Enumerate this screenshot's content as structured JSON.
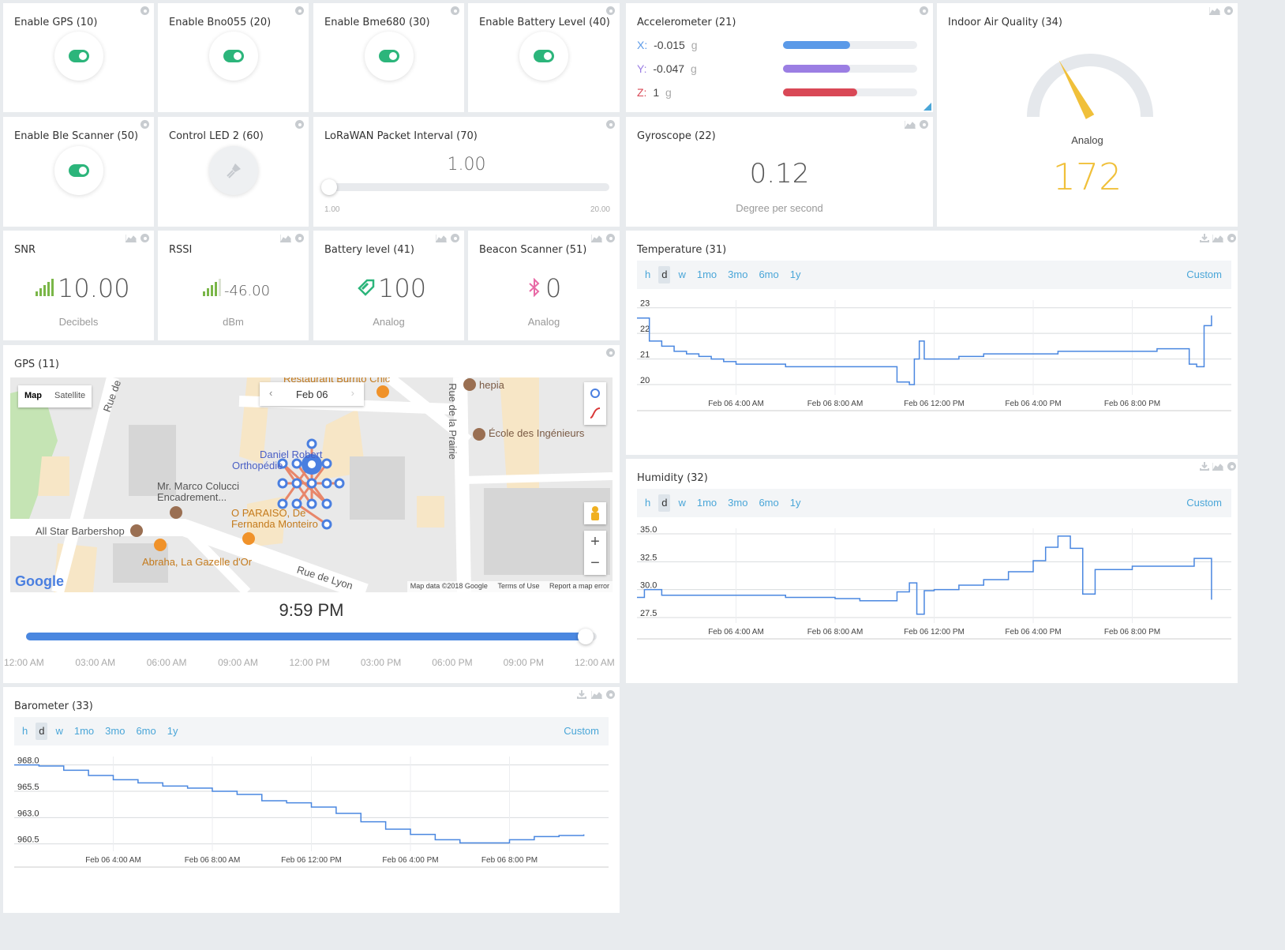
{
  "colors": {
    "accent": "#4a87e0",
    "toggle_on": "#2cb57b",
    "tab_link": "#4aa6d8",
    "gauge": "#f0c03a",
    "battery": "#2cb57b",
    "ble": "#e86aa6",
    "acc_x": "#5b9ae8",
    "acc_y": "#9b7ee3",
    "acc_z": "#d94856"
  },
  "toggles": [
    {
      "title": "Enable GPS (10)",
      "icon": "toggle-on-icon"
    },
    {
      "title": "Enable Bno055 (20)",
      "icon": "toggle-on-icon"
    },
    {
      "title": "Enable Bme680 (30)",
      "icon": "toggle-on-icon"
    },
    {
      "title": "Enable Battery Level (40)",
      "icon": "toggle-on-icon"
    },
    {
      "title": "Enable Ble Scanner (50)",
      "icon": "toggle-on-icon"
    }
  ],
  "led": {
    "title": "Control LED 2 (60)",
    "icon": "led-bulb-icon"
  },
  "lorawan": {
    "title": "LoRaWAN Packet Interval (70)",
    "value": "1.00",
    "min": "1.00",
    "max": "20.00",
    "level": 0.0
  },
  "accelerometer": {
    "title": "Accelerometer (21)",
    "rows": [
      {
        "axis": "X:",
        "value": "-0.015",
        "unit": "g",
        "level": 0.5
      },
      {
        "axis": "Y:",
        "value": "-0.047",
        "unit": "g",
        "level": 0.5
      },
      {
        "axis": "Z:",
        "value": "1",
        "unit": "g",
        "level": 0.55
      }
    ]
  },
  "iaq": {
    "title": "Indoor Air Quality (34)",
    "label": "Analog",
    "value": "172",
    "level": 0.34
  },
  "gyro": {
    "title": "Gyroscope (22)",
    "value": "0.12",
    "unit": "Degree per second"
  },
  "snr": {
    "title": "SNR",
    "value": "10.00",
    "unit": "Decibels",
    "icon": "signal-bars-icon"
  },
  "rssi": {
    "title": "RSSI",
    "value": "-46.00",
    "unit": "dBm",
    "icon": "signal-bars-icon"
  },
  "battery": {
    "title": "Battery level (41)",
    "value": "100",
    "unit": "Analog",
    "icon": "battery-tag-icon"
  },
  "beacon": {
    "title": "Beacon Scanner (51)",
    "value": "0",
    "unit": "Analog",
    "icon": "bluetooth-icon"
  },
  "gps": {
    "title": "GPS (11)",
    "map_type": [
      "Map",
      "Satellite"
    ],
    "date": "Feb 06",
    "time": "9:59 PM",
    "timeline_level": 0.98,
    "timeline_labels": [
      "12:00 AM",
      "03:00 AM",
      "06:00 AM",
      "09:00 AM",
      "12:00 PM",
      "03:00 PM",
      "06:00 PM",
      "09:00 PM",
      "12:00 AM"
    ],
    "places": {
      "restaurant": "Restaurant Burrito Chic",
      "hepia": "hepia",
      "ecole": "École des Ingénieurs",
      "daniel": "Daniel Robert",
      "ortho": "Orthopédie",
      "marco1": "Mr. Marco Colucci",
      "marco2": "Encadrement...",
      "allstar": "All Star Barbershop",
      "paraiso1": "O PARAISO, De",
      "paraiso2": "Fernanda Monteiro",
      "abraha": "Abraha, La Gazelle d'Or",
      "rue_lyon": "Rue de Lyon",
      "rue_prairie": "Rue de la Prairie",
      "rue_de": "Rue de"
    },
    "google": "Google",
    "footer": [
      "Map data ©2018 Google",
      "Terms of Use",
      "Report a map error"
    ],
    "zoom_in": "+",
    "zoom_out": "−"
  },
  "time_tabs": [
    "h",
    "d",
    "w",
    "1mo",
    "3mo",
    "6mo",
    "1y"
  ],
  "custom_label": "Custom",
  "x_ticks": [
    "Feb 06 4:00 AM",
    "Feb 06 8:00 AM",
    "Feb 06 12:00 PM",
    "Feb 06 4:00 PM",
    "Feb 06 8:00 PM"
  ],
  "chart_data": [
    {
      "type": "line",
      "title": "Temperature (31)",
      "yticks": [
        "23",
        "22",
        "21",
        "20"
      ],
      "ylim": [
        19.6,
        23.3
      ],
      "x": [
        0,
        0.5,
        1,
        1.5,
        2,
        2.5,
        3,
        3.5,
        4,
        5,
        6,
        7,
        8,
        9,
        10,
        10.5,
        11,
        11.2,
        11.4,
        11.6,
        12,
        13,
        14,
        15,
        16,
        17,
        18,
        19,
        20,
        21,
        22,
        22.3,
        22.6,
        22.9,
        23.2
      ],
      "values": [
        22.6,
        21.7,
        21.5,
        21.3,
        21.2,
        21.1,
        21.0,
        20.9,
        20.8,
        20.8,
        20.7,
        20.7,
        20.7,
        20.7,
        20.7,
        20.1,
        20.0,
        21.0,
        21.7,
        21.0,
        21.0,
        21.1,
        21.2,
        21.2,
        21.2,
        21.3,
        21.3,
        21.3,
        21.3,
        21.4,
        21.4,
        20.8,
        20.7,
        22.3,
        22.7
      ]
    },
    {
      "type": "line",
      "title": "Humidity (32)",
      "yticks": [
        "35.0",
        "32.5",
        "30.0",
        "27.5"
      ],
      "ylim": [
        27.0,
        35.5
      ],
      "x": [
        0,
        0.3,
        1,
        2,
        3,
        4,
        5,
        6,
        7,
        8,
        9,
        9.5,
        10,
        10.5,
        11,
        11.3,
        11.6,
        12,
        13,
        14,
        15,
        16,
        16.5,
        17,
        17.5,
        18,
        18.5,
        19,
        20,
        21,
        22,
        22.5,
        23,
        23.2
      ],
      "values": [
        29.3,
        30.0,
        29.5,
        29.5,
        29.5,
        29.5,
        29.5,
        29.3,
        29.3,
        29.2,
        29.0,
        29.0,
        29.0,
        29.8,
        30.6,
        27.8,
        29.9,
        30.0,
        30.4,
        30.9,
        31.6,
        32.6,
        33.8,
        34.8,
        33.7,
        29.6,
        31.8,
        31.8,
        32.1,
        32.1,
        32.1,
        32.8,
        32.8,
        29.1
      ]
    },
    {
      "type": "line",
      "title": "Barometer (33)",
      "yticks": [
        "968.0",
        "965.5",
        "963.0",
        "960.5"
      ],
      "ylim": [
        959.8,
        968.8
      ],
      "x": [
        0,
        1,
        2,
        3,
        4,
        5,
        6,
        7,
        8,
        9,
        10,
        11,
        12,
        13,
        14,
        15,
        16,
        17,
        18,
        19,
        20,
        21,
        22,
        23
      ],
      "values": [
        968.0,
        967.9,
        967.5,
        967.0,
        966.6,
        966.3,
        966.0,
        965.8,
        965.5,
        965.2,
        964.6,
        964.4,
        964.0,
        963.4,
        962.6,
        961.9,
        961.4,
        960.9,
        960.6,
        960.6,
        960.9,
        961.2,
        961.3,
        961.4
      ]
    }
  ]
}
